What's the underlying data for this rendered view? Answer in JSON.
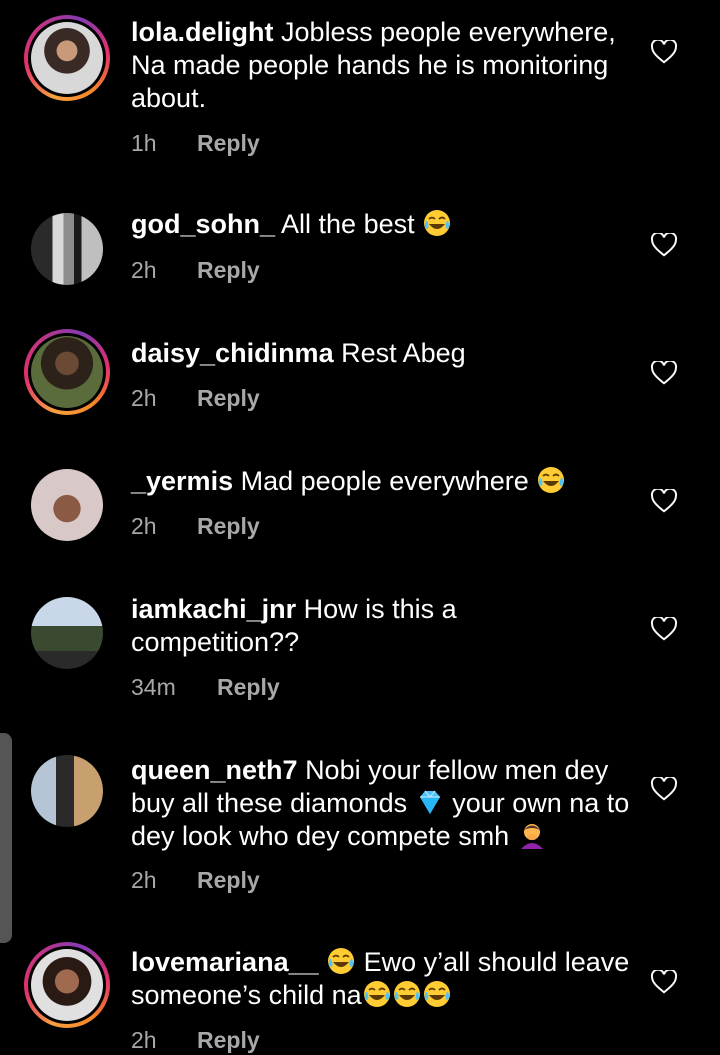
{
  "comments": [
    {
      "username": "lola.delight",
      "text": "Jobless people everywhere, Na made people hands he is monitoring about.",
      "time": "1h",
      "reply": "Reply",
      "story_ring": true
    },
    {
      "username": "god_sohn_",
      "text": "All the best",
      "emoji_after": [
        "laughing-tears"
      ],
      "time": "2h",
      "reply": "Reply",
      "story_ring": false
    },
    {
      "username": "daisy_chidinma",
      "text": "Rest Abeg",
      "time": "2h",
      "reply": "Reply",
      "story_ring": true
    },
    {
      "username": "_yermis",
      "text": "Mad people everywhere",
      "emoji_after": [
        "laughing-tears"
      ],
      "time": "2h",
      "reply": "Reply",
      "story_ring": false
    },
    {
      "username": "iamkachi_jnr",
      "text": "How is this a competition??",
      "time": "34m",
      "reply": "Reply",
      "story_ring": false
    },
    {
      "username": "queen_neth7",
      "text_part1": "Nobi your fellow men dey buy all these diamonds",
      "text_part2": "your own na to dey look who dey compete smh",
      "time": "2h",
      "reply": "Reply",
      "story_ring": false
    },
    {
      "username": "lovemariana__",
      "text": "Ewo y’all should leave someone’s child na",
      "time": "2h",
      "reply": "Reply",
      "story_ring": true
    }
  ],
  "icons": {
    "like": "heart-outline-icon",
    "laugh": "face-with-tears-of-joy",
    "diamond": "gem-stone",
    "facepalm": "person-facepalming"
  },
  "colors": {
    "background": "#000000",
    "text": "#ffffff",
    "secondary": "#a8a8a8"
  }
}
